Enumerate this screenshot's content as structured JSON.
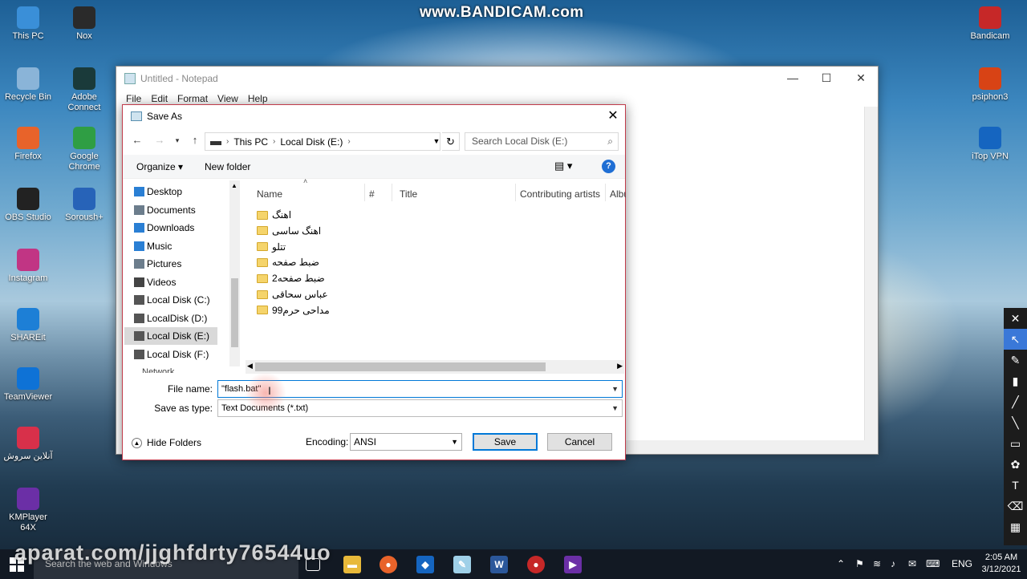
{
  "watermark": "www.BANDICAM.com",
  "aparat": "aparat.com/jjghfdrty76544uo",
  "desktop_icons": [
    {
      "label": "This PC",
      "color": "#3a8fd8"
    },
    {
      "label": "Nox",
      "color": "#2a2a2a"
    },
    {
      "label": "Recycle Bin",
      "color": "#8ab4d8"
    },
    {
      "label": "Adobe Connect",
      "color": "#1a3a3a"
    },
    {
      "label": "Firefox",
      "color": "#e8632a"
    },
    {
      "label": "Google Chrome",
      "color": "#2f9e44"
    },
    {
      "label": "OBS Studio",
      "color": "#222"
    },
    {
      "label": "Soroush+",
      "color": "#2763b8"
    },
    {
      "label": "Instagram",
      "color": "#c13584"
    },
    {
      "label": "SHAREit",
      "color": "#1d7fd6"
    },
    {
      "label": "TeamViewer",
      "color": "#0e72d6"
    },
    {
      "label": "آنلاین سروش",
      "color": "#d8304a"
    },
    {
      "label": "KMPlayer 64X",
      "color": "#6b2fa6"
    },
    {
      "label": "Bandicam",
      "color": "#c62828"
    },
    {
      "label": "psiphon3",
      "color": "#d84315"
    },
    {
      "label": "iTop VPN",
      "color": "#1565c0"
    }
  ],
  "notepad": {
    "title": "Untitled - Notepad",
    "menu": [
      "File",
      "Edit",
      "Format",
      "View",
      "Help"
    ],
    "controls": {
      "min": "—",
      "max": "☐",
      "close": "✕"
    }
  },
  "dialog": {
    "title": "Save As",
    "close": "✕",
    "breadcrumb": [
      "This PC",
      "Local Disk (E:)"
    ],
    "search_placeholder": "Search Local Disk (E:)",
    "organize": "Organize ▾",
    "new_folder": "New folder",
    "nav_items": [
      {
        "label": "Desktop",
        "icon": "desktop-icon",
        "color": "#2a7fd4"
      },
      {
        "label": "Documents",
        "icon": "documents-icon",
        "color": "#6c7d8c"
      },
      {
        "label": "Downloads",
        "icon": "downloads-icon",
        "color": "#2a7fd4"
      },
      {
        "label": "Music",
        "icon": "music-icon",
        "color": "#2a7fd4"
      },
      {
        "label": "Pictures",
        "icon": "pictures-icon",
        "color": "#6c7d8c"
      },
      {
        "label": "Videos",
        "icon": "videos-icon",
        "color": "#444"
      },
      {
        "label": "Local Disk (C:)",
        "icon": "drive-icon",
        "color": "#555"
      },
      {
        "label": "LocalDisk (D:)",
        "icon": "drive-icon",
        "color": "#555"
      },
      {
        "label": "Local Disk (E:)",
        "icon": "drive-icon",
        "color": "#555",
        "selected": true
      },
      {
        "label": "Local Disk (F:)",
        "icon": "drive-icon",
        "color": "#555"
      }
    ],
    "columns": [
      "Name",
      "#",
      "Title",
      "Contributing artists",
      "Albu"
    ],
    "files": [
      "اهنگ",
      "اهنگ ساسی",
      "تتلو",
      "ضبط صفحه",
      "ضبط صفحه2",
      "عباس سحاقی",
      "مداحی حرم99"
    ],
    "file_name_label": "File name:",
    "file_name_value": "\"flash.bat\"",
    "save_type_label": "Save as type:",
    "save_type_value": "Text Documents (*.txt)",
    "hide_folders": "Hide Folders",
    "encoding_label": "Encoding:",
    "encoding_value": "ANSI",
    "save_button": "Save",
    "cancel_button": "Cancel"
  },
  "taskbar": {
    "search": "Search the web and Windows",
    "lang": "ENG",
    "time": "2:05 AM",
    "date": "3/12/2021"
  },
  "annotation_tools": [
    "✕",
    "↖",
    "✎",
    "▮",
    "╱",
    "╲",
    "▭",
    "✿",
    "T",
    "⌫",
    "▦"
  ]
}
